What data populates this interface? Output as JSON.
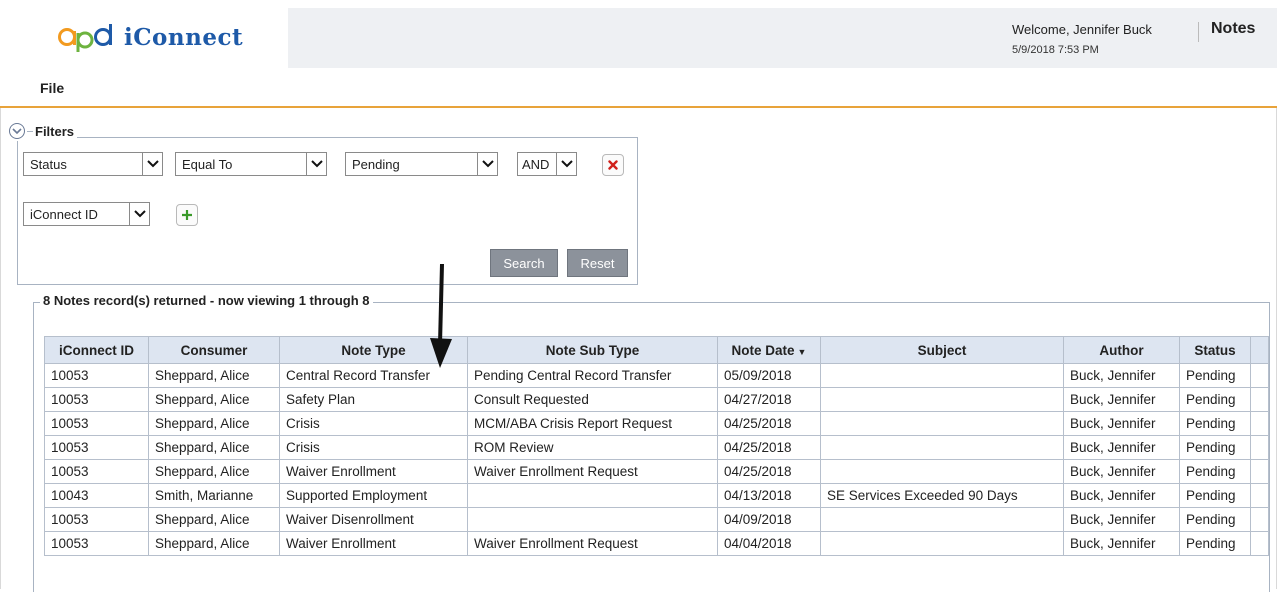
{
  "header": {
    "logo_text": "iConnect",
    "welcome": "Welcome, Jennifer Buck",
    "datetime": "5/9/2018 7:53 PM",
    "module_title": "Notes",
    "band_color": "#eef0f3",
    "logo_color": "#1e5aa8"
  },
  "menu": {
    "file_label": "File",
    "accent": "#e8a33a"
  },
  "filters": {
    "title": "Filters",
    "collapse_icon": "chevron-down-circle-icon",
    "row1": {
      "field": "Status",
      "operator": "Equal To",
      "value": "Pending",
      "conjunction": "AND",
      "remove_icon": "remove-x-icon"
    },
    "row2": {
      "field": "iConnect ID",
      "add_icon": "add-plus-icon"
    },
    "search_label": "Search",
    "reset_label": "Reset"
  },
  "results": {
    "summary": "8 Notes record(s) returned - now viewing 1 through 8",
    "columns": [
      "iConnect ID",
      "Consumer",
      "Note Type",
      "Note Sub Type",
      "Note Date",
      "Subject",
      "Author",
      "Status"
    ],
    "sort_column": "Note Date",
    "sort_direction": "descending",
    "rows": [
      [
        "10053",
        "Sheppard, Alice",
        "Central Record Transfer",
        "Pending Central Record Transfer",
        "05/09/2018",
        "",
        "Buck, Jennifer",
        "Pending"
      ],
      [
        "10053",
        "Sheppard, Alice",
        "Safety Plan",
        "Consult Requested",
        "04/27/2018",
        "",
        "Buck, Jennifer",
        "Pending"
      ],
      [
        "10053",
        "Sheppard, Alice",
        "Crisis",
        "MCM/ABA Crisis Report Request",
        "04/25/2018",
        "",
        "Buck, Jennifer",
        "Pending"
      ],
      [
        "10053",
        "Sheppard, Alice",
        "Crisis",
        "ROM Review",
        "04/25/2018",
        "",
        "Buck, Jennifer",
        "Pending"
      ],
      [
        "10053",
        "Sheppard, Alice",
        "Waiver Enrollment",
        "Waiver Enrollment Request",
        "04/25/2018",
        "",
        "Buck, Jennifer",
        "Pending"
      ],
      [
        "10043",
        "Smith, Marianne",
        "Supported Employment",
        "",
        "04/13/2018",
        "SE Services Exceeded 90 Days",
        "Buck, Jennifer",
        "Pending"
      ],
      [
        "10053",
        "Sheppard, Alice",
        "Waiver Disenrollment",
        "",
        "04/09/2018",
        "",
        "Buck, Jennifer",
        "Pending"
      ],
      [
        "10053",
        "Sheppard, Alice",
        "Waiver Enrollment",
        "Waiver Enrollment Request",
        "04/04/2018",
        "",
        "Buck, Jennifer",
        "Pending"
      ]
    ]
  },
  "annotation": {
    "icon": "down-arrow-icon"
  }
}
